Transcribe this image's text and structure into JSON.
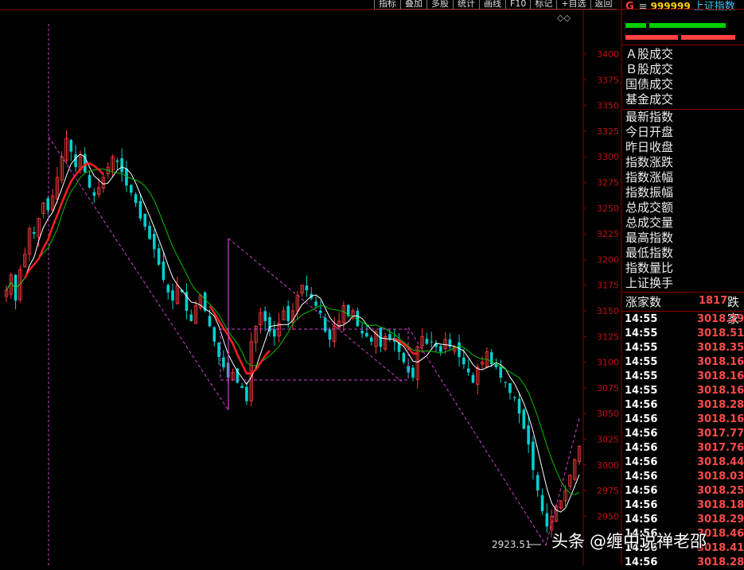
{
  "toolbar": [
    "指标",
    "叠加",
    "多股",
    "统计",
    "画线",
    "F10",
    "标记",
    "+自选",
    "返回"
  ],
  "icons": {
    "toolbar_right": "diamond-icons",
    "header_menu": "menu-icon"
  },
  "header": {
    "letter": "G",
    "menu_glyph": "≡",
    "code": "999999",
    "name": "上证指数"
  },
  "volume_bars": {
    "green_fraction": 0.85,
    "red_fraction": 0.9
  },
  "colors": {
    "up": "#ff3b3b",
    "down": "#00d0d0",
    "ma_white": "#ffffff",
    "ma_green": "#00c000",
    "ma_red": "#ff2020",
    "dash": "#d040d0",
    "grid": "#6b0000"
  },
  "side_labels_top": [
    "Ａ股成交",
    "Ｂ股成交",
    "国债成交",
    "基金成交"
  ],
  "side_labels_mid": [
    "最新指数",
    "今日开盘",
    "昨日收盘",
    "指数涨跌",
    "指数涨幅",
    "指数振幅",
    "总成交额",
    "总成交量",
    "最高指数",
    "最低指数",
    "指数量比",
    "上证换手"
  ],
  "breadth": {
    "label": "涨家数",
    "value": "1817",
    "suffix": "跌家"
  },
  "ticks": [
    {
      "time": "14:55",
      "price": "3018.29"
    },
    {
      "time": "14:55",
      "price": "3018.51"
    },
    {
      "time": "14:55",
      "price": "3018.35"
    },
    {
      "time": "14:55",
      "price": "3018.16"
    },
    {
      "time": "14:55",
      "price": "3018.16"
    },
    {
      "time": "14:55",
      "price": "3018.16"
    },
    {
      "time": "14:56",
      "price": "3018.28"
    },
    {
      "time": "14:56",
      "price": "3018.16"
    },
    {
      "time": "14:56",
      "price": "3017.77"
    },
    {
      "time": "14:56",
      "price": "3017.76"
    },
    {
      "time": "14:56",
      "price": "3018.44"
    },
    {
      "time": "14:56",
      "price": "3018.03"
    },
    {
      "time": "14:56",
      "price": "3018.25"
    },
    {
      "time": "14:56",
      "price": "3018.18"
    },
    {
      "time": "14:56",
      "price": "3018.29"
    },
    {
      "time": "14:56",
      "price": "3018.46"
    },
    {
      "time": "14:56",
      "price": "3018.41"
    },
    {
      "time": "14:56",
      "price": "3018.28"
    }
  ],
  "watermark": {
    "brand": "头条",
    "handle": "@缠中说禅老邵"
  },
  "chart_data": {
    "type": "candlestick",
    "ylim": [
      2923.51,
      3420
    ],
    "y_ticks": [
      2950,
      2975,
      3000,
      3025,
      3050,
      3075,
      3100,
      3125,
      3150,
      3175,
      3200,
      3225,
      3250,
      3275,
      3300,
      3325,
      3350,
      3375,
      3400
    ],
    "low_annotation": "2923.51",
    "series_note": "daily K-line with moving averages",
    "closes": [
      3170,
      3185,
      3160,
      3190,
      3205,
      3230,
      3225,
      3240,
      3255,
      3248,
      3262,
      3280,
      3300,
      3318,
      3305,
      3290,
      3300,
      3285,
      3270,
      3262,
      3270,
      3280,
      3290,
      3300,
      3295,
      3285,
      3272,
      3265,
      3255,
      3240,
      3232,
      3220,
      3210,
      3195,
      3180,
      3168,
      3160,
      3175,
      3168,
      3150,
      3140,
      3155,
      3165,
      3150,
      3135,
      3120,
      3105,
      3095,
      3085,
      3090,
      3080,
      3075,
      3062,
      3120,
      3135,
      3148,
      3140,
      3130,
      3125,
      3138,
      3150,
      3140,
      3150,
      3165,
      3175,
      3170,
      3162,
      3155,
      3148,
      3130,
      3122,
      3135,
      3140,
      3155,
      3145,
      3150,
      3135,
      3128,
      3125,
      3120,
      3130,
      3115,
      3125,
      3122,
      3120,
      3110,
      3100,
      3090,
      3085,
      3115,
      3125,
      3118,
      3120,
      3115,
      3110,
      3122,
      3115,
      3115,
      3105,
      3098,
      3090,
      3080,
      3095,
      3100,
      3110,
      3098,
      3095,
      3085,
      3080,
      3070,
      3065,
      3050,
      3035,
      3020,
      2995,
      2975,
      2955,
      2940,
      2950,
      2960,
      2965,
      2975,
      2990,
      3005,
      3018
    ]
  }
}
